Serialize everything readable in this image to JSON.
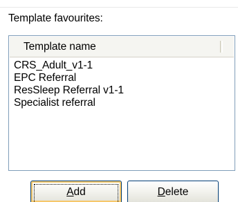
{
  "group": {
    "label": "Template favourites:"
  },
  "list": {
    "column_header": "Template name",
    "items": [
      "CRS_Adult_v1-1",
      "EPC Referral",
      "ResSleep Referral v1-1",
      "Specialist referral"
    ]
  },
  "buttons": {
    "add": {
      "mnemonic": "A",
      "rest": "dd"
    },
    "delete": {
      "mnemonic": "D",
      "rest": "elete"
    }
  }
}
